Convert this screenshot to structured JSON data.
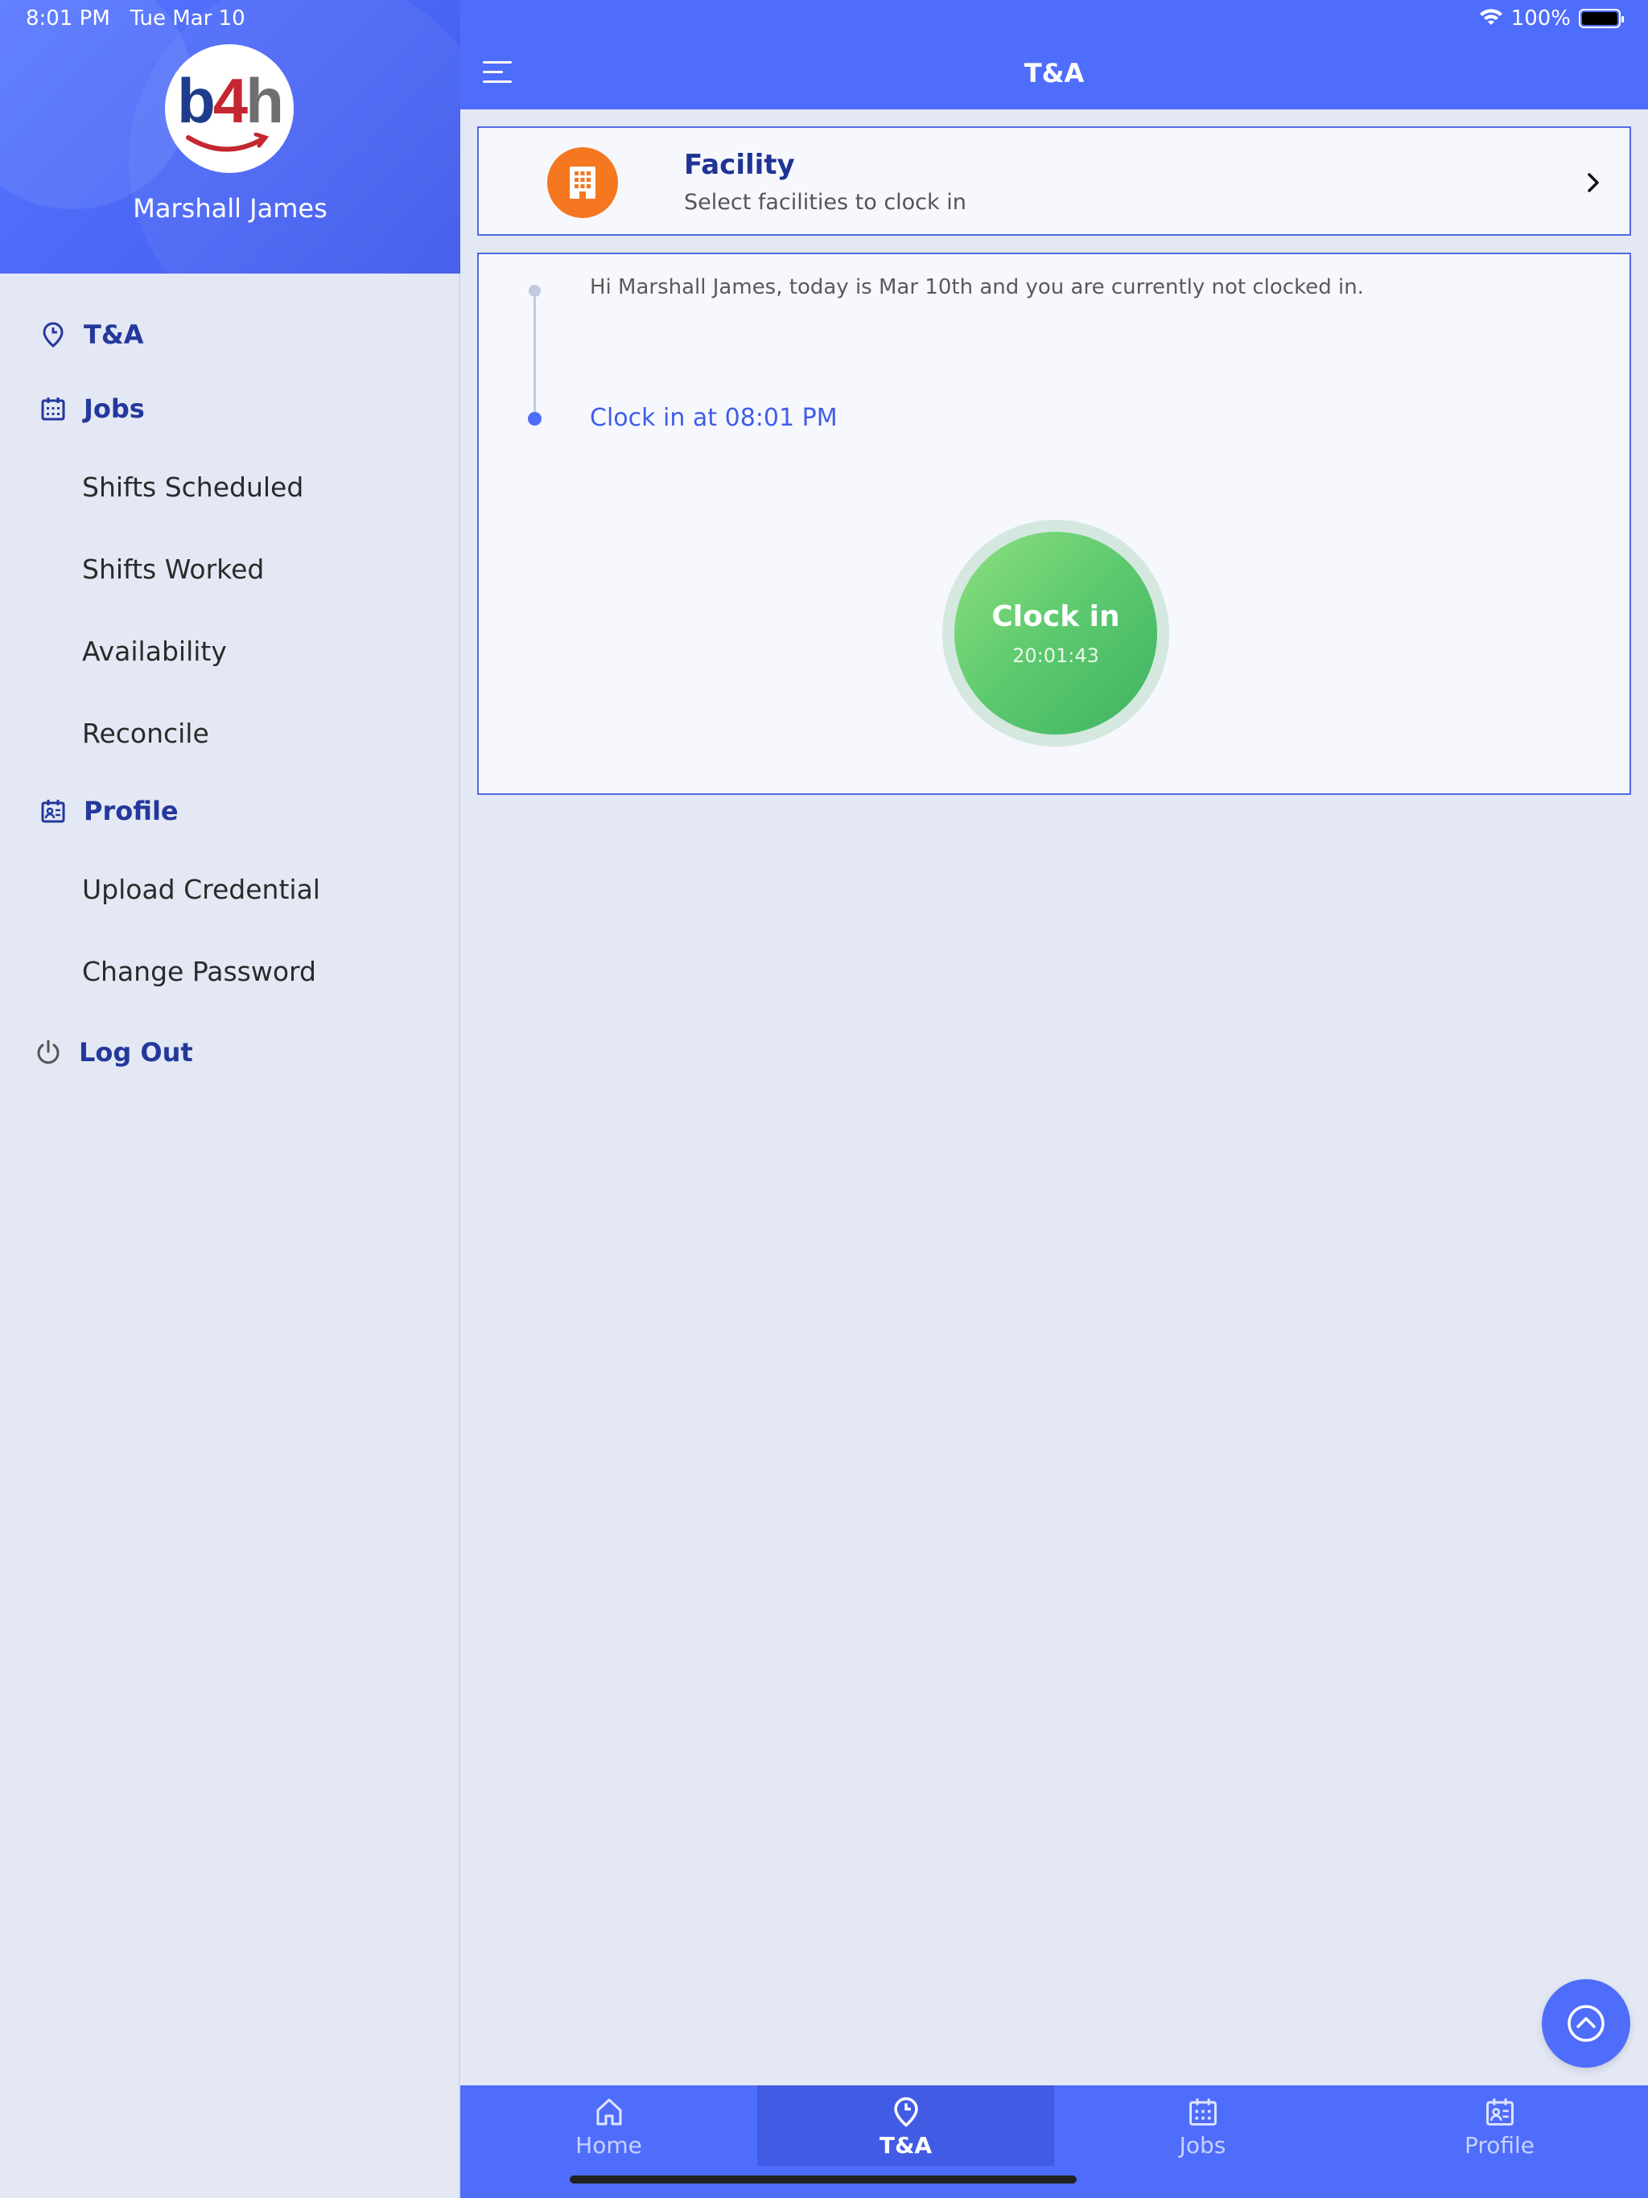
{
  "status_bar": {
    "time": "8:01 PM",
    "date": "Tue Mar 10",
    "battery_percent": "100%"
  },
  "sidebar": {
    "logo": "b4h",
    "user_name": "Marshall James",
    "items": [
      {
        "label": "T&A",
        "icon": "location-clock-icon",
        "type": "section"
      },
      {
        "label": "Jobs",
        "icon": "calendar-icon",
        "type": "section"
      },
      {
        "label": "Shifts Scheduled",
        "type": "sub"
      },
      {
        "label": "Shifts Worked",
        "type": "sub"
      },
      {
        "label": "Availability",
        "type": "sub"
      },
      {
        "label": "Reconcile",
        "type": "sub"
      },
      {
        "label": "Profile",
        "icon": "profile-card-icon",
        "type": "section"
      },
      {
        "label": "Upload Credential",
        "type": "sub"
      },
      {
        "label": "Change Password",
        "type": "sub"
      },
      {
        "label": "Log Out",
        "icon": "power-icon",
        "type": "section"
      }
    ]
  },
  "app_bar": {
    "title": "T&A"
  },
  "facility": {
    "title": "Facility",
    "subtitle": "Select facilities to clock in",
    "icon": "building-icon",
    "icon_color": "#f5771f"
  },
  "status": {
    "message": "Hi Marshall James, today is Mar 10th and you are currently not clocked in.",
    "clock_in_time": "Clock in at 08:01 PM"
  },
  "clock_button": {
    "label": "Clock in",
    "time": "20:01:43"
  },
  "bottom_nav": {
    "items": [
      {
        "label": "Home",
        "icon": "home-icon",
        "active": false
      },
      {
        "label": "T&A",
        "icon": "location-clock-icon",
        "active": true
      },
      {
        "label": "Jobs",
        "icon": "calendar-icon",
        "active": false
      },
      {
        "label": "Profile",
        "icon": "profile-card-icon",
        "active": false
      }
    ]
  },
  "colors": {
    "primary": "#4f6dfb",
    "primary_dark": "#24389c",
    "accent_orange": "#f5771f",
    "clock_green": "#5cc96e",
    "background": "#e3e8f4"
  }
}
